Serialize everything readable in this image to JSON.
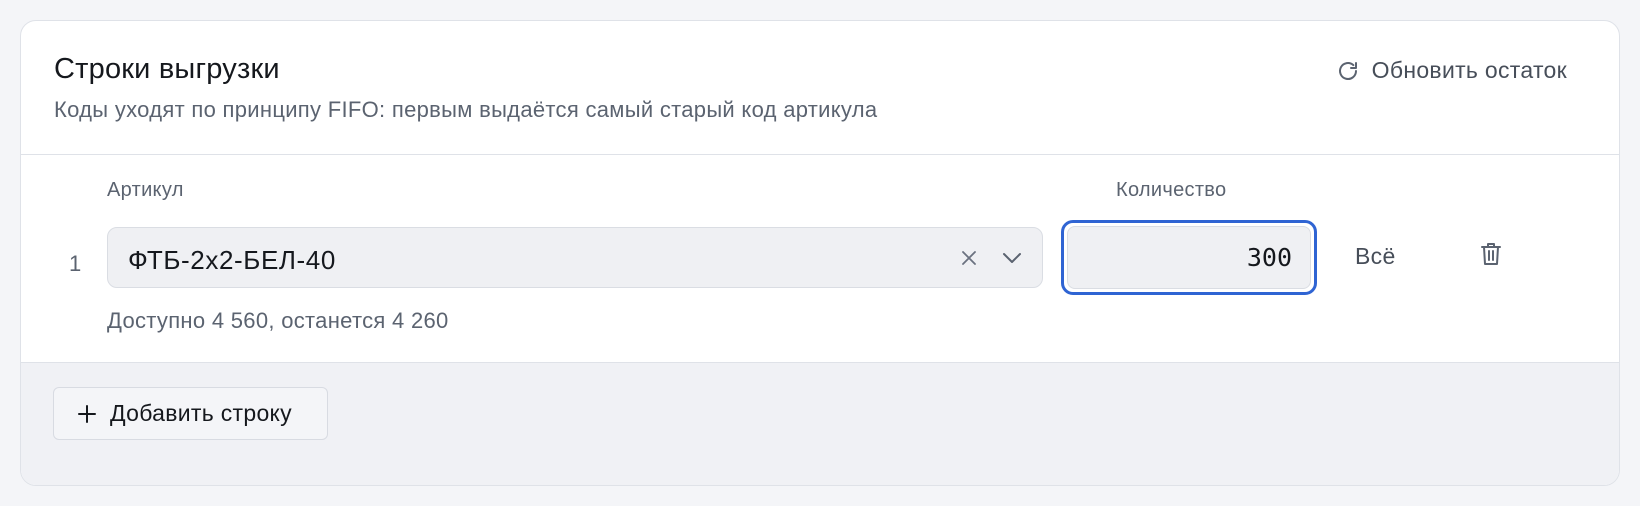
{
  "header": {
    "title": "Строки выгрузки",
    "subtitle": "Коды уходят по принципу FIFO: первым выдаётся самый старый код артикула",
    "refresh_label": "Обновить остаток",
    "refresh_icon": "refresh-icon"
  },
  "columns": {
    "sku_label": "Артикул",
    "qty_label": "Количество"
  },
  "rows": [
    {
      "number": "1",
      "sku": "ФТБ-2х2-БЕЛ-40",
      "quantity": "300",
      "all_label": "Всё",
      "availability": "Доступно 4 560, останется 4 260"
    }
  ],
  "footer": {
    "add_row_label": "Добавить строку",
    "add_icon": "plus-icon"
  },
  "colors": {
    "accent": "#2f64d3",
    "card_bg": "#ffffff",
    "footer_bg": "#f0f1f5",
    "field_bg": "#eff0f3"
  }
}
